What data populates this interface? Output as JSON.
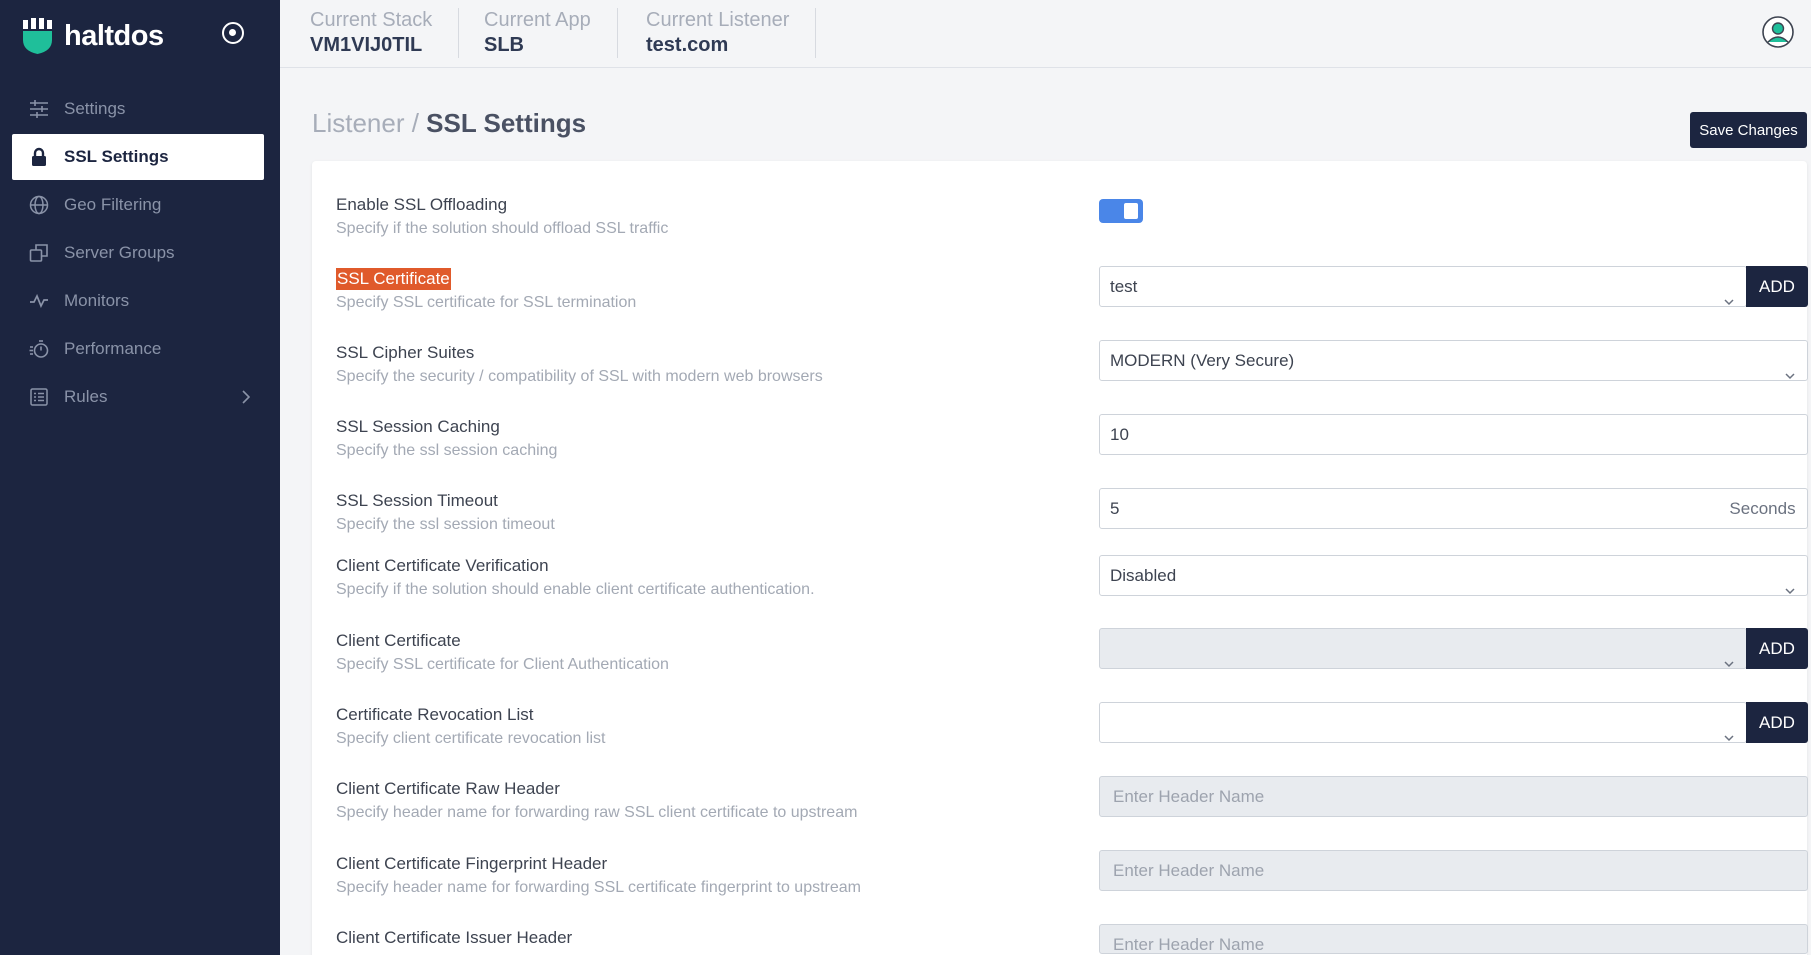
{
  "brand": {
    "name": "haltdos"
  },
  "sidebar": {
    "items": [
      {
        "label": "Settings",
        "icon": "sliders-icon"
      },
      {
        "label": "SSL Settings",
        "icon": "lock-icon"
      },
      {
        "label": "Geo Filtering",
        "icon": "globe-icon"
      },
      {
        "label": "Server Groups",
        "icon": "server-groups-icon"
      },
      {
        "label": "Monitors",
        "icon": "pulse-icon"
      },
      {
        "label": "Performance",
        "icon": "stopwatch-icon"
      },
      {
        "label": "Rules",
        "icon": "list-icon"
      }
    ],
    "active": "SSL Settings"
  },
  "header": {
    "stack_label": "Current Stack",
    "stack_value": "VM1VIJ0TIL",
    "app_label": "Current App",
    "app_value": "SLB",
    "listener_label": "Current Listener",
    "listener_value": "test.com"
  },
  "page": {
    "breadcrumb_parent": "Listener",
    "breadcrumb_sep": " / ",
    "title": "SSL Settings",
    "save_label": "Save Changes"
  },
  "form": {
    "ssl_offloading": {
      "title": "Enable SSL Offloading",
      "desc": "Specify if the solution should offload SSL traffic",
      "enabled": true
    },
    "ssl_certificate": {
      "title": "SSL Certificate",
      "desc": "Specify SSL certificate for SSL termination",
      "value": "test",
      "add_label": "ADD"
    },
    "cipher_suites": {
      "title": "SSL Cipher Suites",
      "desc": "Specify the security / compatibility of SSL with modern web browsers",
      "value": "MODERN (Very Secure)"
    },
    "session_caching": {
      "title": "SSL Session Caching",
      "desc": "Specify the ssl session caching",
      "value": "10"
    },
    "session_timeout": {
      "title": "SSL Session Timeout",
      "desc": "Specify the ssl session timeout",
      "value": "5",
      "unit": "Seconds"
    },
    "client_verification": {
      "title": "Client Certificate Verification",
      "desc": "Specify if the solution should enable client certificate authentication.",
      "value": "Disabled"
    },
    "client_certificate": {
      "title": "Client Certificate",
      "desc": "Specify SSL certificate for Client Authentication",
      "value": "",
      "add_label": "ADD"
    },
    "revocation_list": {
      "title": "Certificate Revocation List",
      "desc": "Specify client certificate revocation list",
      "value": "",
      "add_label": "ADD"
    },
    "raw_header": {
      "title": "Client Certificate Raw Header",
      "desc": "Specify header name for forwarding raw SSL client certificate to upstream",
      "placeholder": "Enter Header Name"
    },
    "fingerprint_header": {
      "title": "Client Certificate Fingerprint Header",
      "desc": "Specify header name for forwarding SSL certificate fingerprint to upstream",
      "placeholder": "Enter Header Name"
    },
    "issuer_header": {
      "title": "Client Certificate Issuer Header",
      "desc": "",
      "placeholder": "Enter Header Name"
    }
  },
  "colors": {
    "sidebar": "#1c2540",
    "accent": "#4a86e8",
    "highlight": "#e05a2b",
    "brand_mark": "#1fbf9a"
  }
}
